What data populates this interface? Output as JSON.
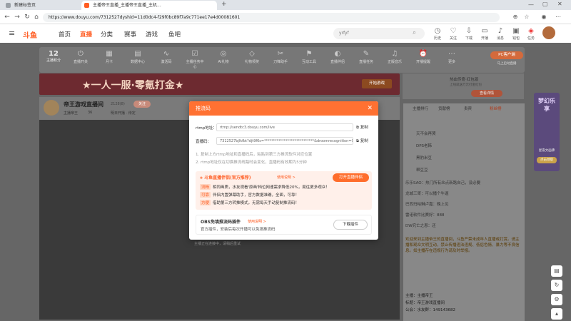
{
  "browser": {
    "tabs": [
      {
        "label": "新建标签页"
      },
      {
        "label": "主播帝王直播_主播帝王直播_主机..."
      }
    ],
    "new_tab": "+",
    "url": "https://www.douyu.com/7312527dyshid=11d0dc4-f29f0bc89f7a9c771ee17e4d00081601",
    "back": "←",
    "forward": "→",
    "reload": "↻",
    "home": "⌂"
  },
  "site": {
    "logo": "斗鱼",
    "nav": [
      "首页",
      "直播",
      "分类",
      "赛事",
      "游戏",
      "鱼吧"
    ],
    "search_placeholder": "yrfyf",
    "header_icons": [
      "历史",
      "关注",
      "下载",
      "开播",
      "消息",
      "钱包",
      "任务"
    ]
  },
  "toolbar": {
    "level": "12",
    "level_label": "主播积分",
    "items": [
      "直播开关",
      "月卡",
      "数据中心",
      "激活码",
      "主播任务中心",
      "AI礼物",
      "礼物领奖",
      "刀锋助手",
      "互动工具",
      "直播伴侣",
      "直播任务",
      "正版音乐",
      "开播提醒",
      "更多"
    ],
    "pc_badge": "PC客户端",
    "pc_sub": "马上启动直播"
  },
  "banner": {
    "text": "★一人一服·零氪打金★",
    "cta": "开始游戏",
    "aside_title": "热血传奇·红包版",
    "aside_sub": "上线就送万元打金红包",
    "aside_btn": "查看详情"
  },
  "streamer": {
    "name": "帝王游戏直播间",
    "room_id": "2128(8)",
    "follow_btn": "关注",
    "tag": "主播帝王",
    "count": "36",
    "schedule": "明日开播 · 待定",
    "fans": "2周年"
  },
  "chat": {
    "tabs": [
      "主播排行",
      "贡献榜",
      "贵宾",
      "粉丝榜"
    ],
    "ranks": [
      "天不会再哭",
      "DPS老韩",
      "黑豹米豆",
      "帮豆豆"
    ],
    "lines": [
      "乐乐SAO：热门所有众点新路自己，没必要",
      "龙城三哥：可以播个牛逼",
      "巴西玛帕琳卢嘉：晚上见",
      "雷诺软件比赛好：888",
      "DW究亡之恩：还"
    ],
    "notice": "欢迎来到主播帝王的直播间，斗鱼严禁未成年人直播或打赏。请主播和观众文明互动，禁止传播违法违规、低俗色情、暴力等不良信息。如主播存在违规行为请及时举报。",
    "host_label": "主播：",
    "host": "主播帝王",
    "title_label": "标题：",
    "title": "帝王游戏直播间",
    "fans_label": "公会：",
    "fans_val": "水友群：149143682"
  },
  "player": {
    "message": "主播正在连接中，请稍后重试"
  },
  "side_ad": {
    "title": "梦幻乐享",
    "sub": "星夜文画佛",
    "btn": "点击领取"
  },
  "modal": {
    "title": "推流码",
    "close": "✕",
    "rtmp_label": "rtmp地址：",
    "rtmp_value": "rtmp://sendtc3.douyu.com/live",
    "code_label": "直播码：",
    "code_value": "7312527bjlkfbt?djt9f6s=****************************&droomrecognition=0",
    "copy": "复制",
    "notes": [
      "1. 复制上方rtmp地址和直播码后，粘贴到第三方推流软件对应位置",
      "2. rtmp地址仅在切换推流线路时会变化，直播码有效期为5分钟"
    ],
    "promo": {
      "title": "斗鱼直播伴侣(官方推荐)",
      "link": "使用说明 >",
      "button": "打开直播伴侣",
      "rows": [
        {
          "tag": "流畅",
          "text": "相同画质，水友观看'原画'档位网速需求降低20%，局往更多观众！"
        },
        {
          "tag": "可靠",
          "text": "伴侣内置弹幕助手，官方数据准确，全面，可靠！"
        },
        {
          "tag": "方便",
          "text": "借助第三方转推模式，无需每天手动复制推流码！"
        }
      ]
    },
    "plugin": {
      "title": "OBS免填推流码插件",
      "link": "使用说明 >",
      "desc": "官方插件，安装后每次开播可以免填推流码",
      "button": "下载插件"
    }
  },
  "colors": {
    "accent": "#ff7132",
    "brand": "#ff5d23"
  }
}
